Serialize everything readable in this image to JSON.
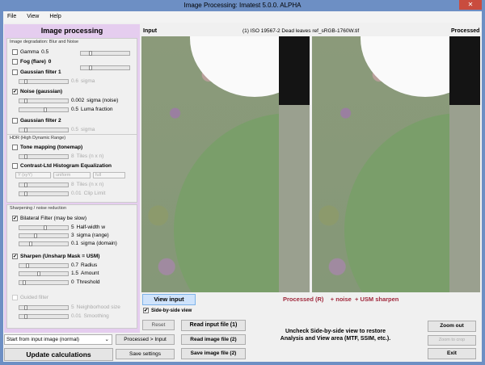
{
  "window": {
    "title": "Image Processing:  Imatest 5.0.0. ALPHA",
    "close": "✕"
  },
  "menu": [
    "File",
    "View",
    "Help"
  ],
  "left": {
    "header": "Image processing",
    "degradation": {
      "title": "Image degradation: Blur and Noise",
      "gamma": {
        "label": "Gamma",
        "value": "0.5",
        "checked": false
      },
      "fog": {
        "label": "Fog (flare)",
        "value": "0",
        "checked": false
      },
      "gauss1": {
        "label": "Gaussian filter 1",
        "value": "0.6",
        "unit": "sigma",
        "checked": false
      },
      "noise": {
        "label": "Noise (gaussian)",
        "checked": true,
        "sigma": "0.002",
        "sigma_label": "sigma (noise)",
        "luma": "0.5",
        "luma_label": "Luma fraction"
      },
      "gauss2": {
        "label": "Gaussian filter 2",
        "value": "0.5",
        "unit": "sigma",
        "checked": false
      }
    },
    "hdr": {
      "title": "HDR (High Dynamic Range)",
      "tone": {
        "label": "Tone mapping (tonemap)",
        "checked": false,
        "value": "8",
        "unit": "Tiles (n x n)"
      },
      "clahe": {
        "label": "Contrast-Ltd Histogram Equalization",
        "checked": false,
        "dd1": "Y (xyY)",
        "dd2": "uniform",
        "dd3": "full",
        "tiles": "8",
        "tiles_label": "Tiles (n x n)",
        "clip": "0.01",
        "clip_label": "Clip Limit"
      }
    },
    "sharp": {
      "title": "Sharpening / noise reduction",
      "bilateral": {
        "label": "Bilateral Filter  (may be slow)",
        "checked": true,
        "hw": "5",
        "hw_label": "Half-width w",
        "sr": "3",
        "sr_label": "sigma (range)",
        "sd": "0.1",
        "sd_label": "sigma (domain)"
      },
      "usm": {
        "label": "Sharpen (Unsharp Mask = USM)",
        "checked": true,
        "radius": "0.7",
        "radius_label": "Radius",
        "amount": "1.5",
        "amount_label": "Amount",
        "thr": "0",
        "thr_label": "Threshold"
      },
      "guided": {
        "label": "Guided filter",
        "checked": false,
        "n": "5",
        "n_label": "Neighborhood size",
        "s": "0.01",
        "s_label": "Smoothing"
      }
    },
    "start_select": "Start from input image (normal)",
    "update": "Update calculations",
    "reset": "Reset",
    "proc_input": "Processed > Input",
    "save_settings": "Save settings"
  },
  "view": {
    "input_label": "Input",
    "file_label": "(1) ISO 19567-2 Dead leaves ref_sRGB-1760W.tif",
    "processed_label": "Processed",
    "view_input": "View input",
    "side_by_side": "Side-by-side view",
    "side_checked": true,
    "status": "Processed (R)    + noise  + USM sharpen",
    "status_color": "#a0283c"
  },
  "buttons": {
    "read_input": "Read input file (1)",
    "read_image": "Read image file (2)",
    "save_image": "Save image file (2)",
    "zoom_out": "Zoom out",
    "zoom_crop": "Zoom to crop",
    "exit": "Exit"
  },
  "hint": "Uncheck Side-by-side view to restore Analysis and View area (MTF, SSIM, etc.)."
}
